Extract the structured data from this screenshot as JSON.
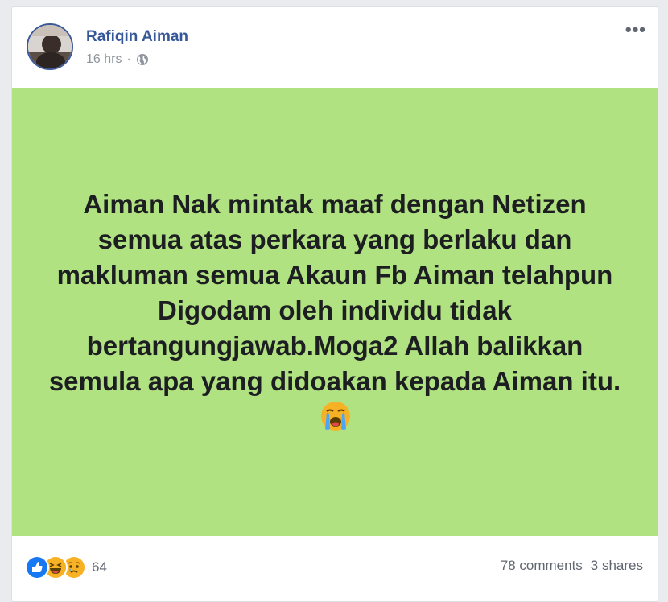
{
  "post": {
    "author": "Rafiqin Aiman",
    "time": "16 hrs",
    "separator": "·",
    "privacy_icon": "globe-icon",
    "more_label": "•••",
    "text_body": "Aiman Nak mintak maaf dengan Netizen semua atas perkara yang berlaku dan makluman semua Akaun Fb Aiman telahpun Digodam oleh individu tidak bertangungjawab.Moga2 Allah balikkan semula apa yang didoakan kepada Aiman itu.",
    "trailing_emoji": "loudly-crying-face-icon",
    "background_color": "#b1e281"
  },
  "footer": {
    "reactions": [
      "like-icon",
      "haha-icon",
      "sad-icon"
    ],
    "reaction_count": "64",
    "comments": "78 comments",
    "shares": "3 shares"
  },
  "colors": {
    "author": "#365899",
    "meta": "#90949c",
    "like": "#1877f2",
    "emoji": "#f7b125"
  }
}
